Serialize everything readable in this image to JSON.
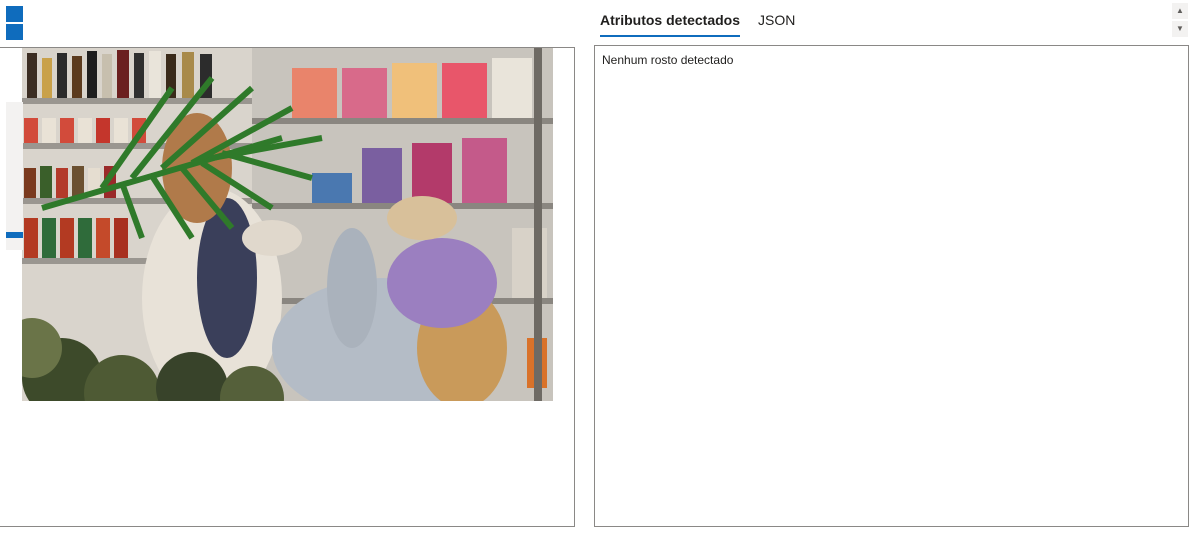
{
  "tabs": [
    {
      "label": "Atributos detectados",
      "active": true
    },
    {
      "label": "JSON",
      "active": false
    }
  ],
  "results": {
    "message": "Nenhum rosto detectado"
  },
  "scroll": {
    "up_icon": "▲",
    "down_icon": "▼"
  },
  "image": {
    "description_icon": "grocery-store-photo",
    "zoom_level": 0.1
  },
  "colors": {
    "accent": "#0f6cbd",
    "border": "#8a8886"
  }
}
